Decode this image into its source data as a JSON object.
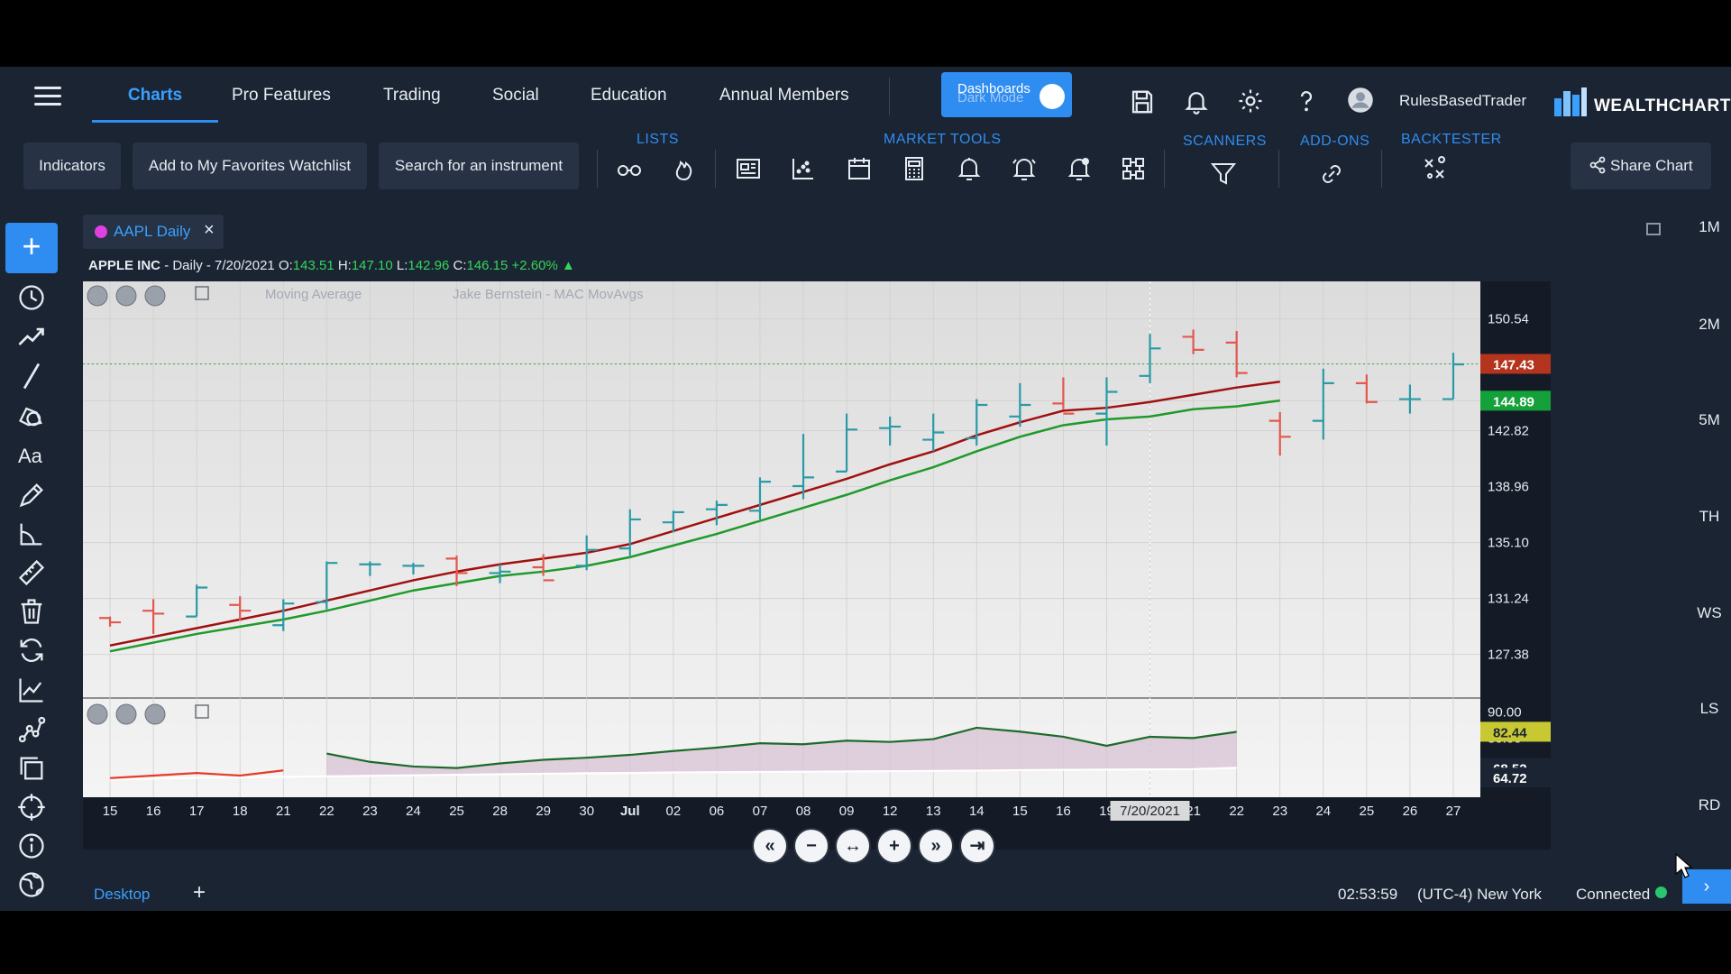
{
  "nav": {
    "tabs": [
      "Charts",
      "Pro Features",
      "Trading",
      "Social",
      "Education",
      "Annual Members"
    ],
    "active_tab": "Charts",
    "dashboards_label": "Dashboards",
    "darkmode_label": "Dark Mode",
    "username": "RulesBasedTrader",
    "brand": "WEALTHCHARTS"
  },
  "toolbar": {
    "indicators": "Indicators",
    "favorites": "Add to My Favorites Watchlist",
    "search": "Search for an instrument",
    "groups": {
      "lists": "LISTS",
      "market_tools": "MARKET TOOLS",
      "scanners": "SCANNERS",
      "addons": "ADD-ONS",
      "backtester": "BACKTESTER"
    },
    "share": "Share Chart"
  },
  "chart_tab": {
    "label": "AAPL Daily",
    "close": "×"
  },
  "chart_info": {
    "name": "APPLE INC",
    "interval": "- Daily - 7/20/2021",
    "o_label": "O:",
    "o": "143.51",
    "h_label": "H:",
    "h": "147.10",
    "l_label": "L:",
    "l": "142.96",
    "c_label": "C:",
    "c": "146.15",
    "change": "+2.60%",
    "arrow": "▲"
  },
  "indicators": {
    "ma": "Moving Average",
    "mac": "Jake Bernstein - MAC MovAvgs"
  },
  "timeframes": [
    "1M",
    "2M",
    "5M",
    "TH",
    "WS",
    "LS",
    "RD"
  ],
  "status": {
    "desktop_tab": "Desktop",
    "add": "+",
    "time": "02:53:59",
    "timezone": "(UTC-4) New York",
    "connection": "Connected"
  },
  "chart_data": {
    "type": "ohlc",
    "x_labels": [
      "15",
      "16",
      "17",
      "18",
      "21",
      "22",
      "23",
      "24",
      "25",
      "28",
      "29",
      "30",
      "Jul",
      "02",
      "06",
      "07",
      "08",
      "09",
      "12",
      "13",
      "14",
      "15",
      "16",
      "19",
      "20",
      "21",
      "22",
      "23",
      "24",
      "25",
      "26",
      "27"
    ],
    "crosshair_date": "7/20/2021",
    "price_axis": {
      "ticks": [
        "150.54",
        "147.43",
        "144.89",
        "142.82",
        "138.96",
        "135.10",
        "131.24",
        "127.38"
      ],
      "ylim": [
        125.0,
        152.5
      ]
    },
    "price_labels": {
      "last": "147.43",
      "ma": "144.89"
    },
    "bars": [
      {
        "o": 129.9,
        "h": 130.0,
        "l": 129.3,
        "c": 129.6
      },
      {
        "o": 130.4,
        "h": 131.2,
        "l": 128.8,
        "c": 130.2
      },
      {
        "o": 130.0,
        "h": 132.2,
        "l": 130.0,
        "c": 132.0
      },
      {
        "o": 130.8,
        "h": 131.4,
        "l": 129.7,
        "c": 130.4
      },
      {
        "o": 129.4,
        "h": 131.2,
        "l": 129.0,
        "c": 130.9
      },
      {
        "o": 131.0,
        "h": 133.8,
        "l": 130.5,
        "c": 133.7
      },
      {
        "o": 133.6,
        "h": 133.8,
        "l": 132.8,
        "c": 133.6
      },
      {
        "o": 133.5,
        "h": 133.7,
        "l": 132.9,
        "c": 133.5
      },
      {
        "o": 134.0,
        "h": 134.2,
        "l": 132.1,
        "c": 133.0
      },
      {
        "o": 133.0,
        "h": 133.6,
        "l": 132.3,
        "c": 133.1
      },
      {
        "o": 133.4,
        "h": 134.3,
        "l": 132.8,
        "c": 132.5
      },
      {
        "o": 133.5,
        "h": 135.6,
        "l": 133.2,
        "c": 134.6
      },
      {
        "o": 134.7,
        "h": 137.4,
        "l": 134.2,
        "c": 136.7
      },
      {
        "o": 136.5,
        "h": 137.3,
        "l": 135.8,
        "c": 137.2
      },
      {
        "o": 137.4,
        "h": 138.0,
        "l": 136.3,
        "c": 137.7
      },
      {
        "o": 137.3,
        "h": 139.6,
        "l": 136.7,
        "c": 139.3
      },
      {
        "o": 139.0,
        "h": 142.6,
        "l": 138.1,
        "c": 139.6
      },
      {
        "o": 140.0,
        "h": 144.0,
        "l": 140.0,
        "c": 142.9
      },
      {
        "o": 143.0,
        "h": 143.8,
        "l": 141.8,
        "c": 143.1
      },
      {
        "o": 142.2,
        "h": 144.0,
        "l": 141.4,
        "c": 142.7
      },
      {
        "o": 142.3,
        "h": 145.0,
        "l": 141.8,
        "c": 144.6
      },
      {
        "o": 143.8,
        "h": 146.1,
        "l": 143.1,
        "c": 144.6
      },
      {
        "o": 144.7,
        "h": 146.5,
        "l": 144.3,
        "c": 144.0
      },
      {
        "o": 144.0,
        "h": 146.5,
        "l": 141.8,
        "c": 145.5
      },
      {
        "o": 146.6,
        "h": 149.5,
        "l": 146.1,
        "c": 148.5
      },
      {
        "o": 149.3,
        "h": 149.8,
        "l": 148.1,
        "c": 148.4
      },
      {
        "o": 148.9,
        "h": 149.7,
        "l": 146.5,
        "c": 146.8
      },
      {
        "o": 143.5,
        "h": 144.1,
        "l": 141.1,
        "c": 142.4
      },
      {
        "o": 143.5,
        "h": 147.1,
        "l": 142.2,
        "c": 146.1
      },
      {
        "o": 146.1,
        "h": 146.7,
        "l": 144.7,
        "c": 144.8
      },
      {
        "o": 145.0,
        "h": 146.0,
        "l": 144.0,
        "c": 145.0
      },
      {
        "o": 145.0,
        "h": 148.2,
        "l": 145.0,
        "c": 147.4
      }
    ],
    "ma_red": [
      128.0,
      128.6,
      129.2,
      129.8,
      130.4,
      131.1,
      131.8,
      132.5,
      133.1,
      133.6,
      134.0,
      134.4,
      135.0,
      135.9,
      136.8,
      137.7,
      138.6,
      139.5,
      140.5,
      141.4,
      142.5,
      143.4,
      144.2,
      144.4,
      144.8,
      145.3,
      145.8,
      146.2
    ],
    "ma_green": [
      127.6,
      128.2,
      128.8,
      129.3,
      129.8,
      130.4,
      131.1,
      131.8,
      132.3,
      132.8,
      133.1,
      133.5,
      134.1,
      134.9,
      135.7,
      136.6,
      137.5,
      138.4,
      139.4,
      140.3,
      141.4,
      142.4,
      143.2,
      143.6,
      143.8,
      144.3,
      144.5,
      144.9
    ],
    "oscillator": {
      "ticks": [
        "90.00",
        "80.00",
        "70.00"
      ],
      "labels": [
        "82.44",
        "68.52",
        "64.72"
      ],
      "ylim": [
        62,
        92
      ],
      "green": [
        null,
        null,
        null,
        null,
        null,
        74.0,
        70.8,
        69.0,
        68.4,
        70.2,
        71.6,
        72.4,
        73.5,
        75.0,
        76.3,
        78.0,
        77.6,
        79.0,
        78.5,
        79.6,
        84.0,
        82.5,
        80.5,
        77.0,
        80.5,
        80.0,
        82.4
      ],
      "red": [
        64.5,
        65.5,
        66.5,
        65.5,
        67.5,
        null,
        null,
        null,
        null,
        null,
        null,
        null,
        null,
        null,
        null,
        null,
        null,
        null,
        null,
        null,
        null,
        null,
        null,
        null,
        null,
        null,
        null
      ],
      "white": [
        64.0,
        64.3,
        64.6,
        64.8,
        65.0,
        65.2,
        65.4,
        65.6,
        65.8,
        66.0,
        66.2,
        66.4,
        66.5,
        66.7,
        66.8,
        66.9,
        67.0,
        67.1,
        67.2,
        67.3,
        67.4,
        67.6,
        67.7,
        67.8,
        67.9,
        68.0,
        68.5
      ]
    }
  }
}
